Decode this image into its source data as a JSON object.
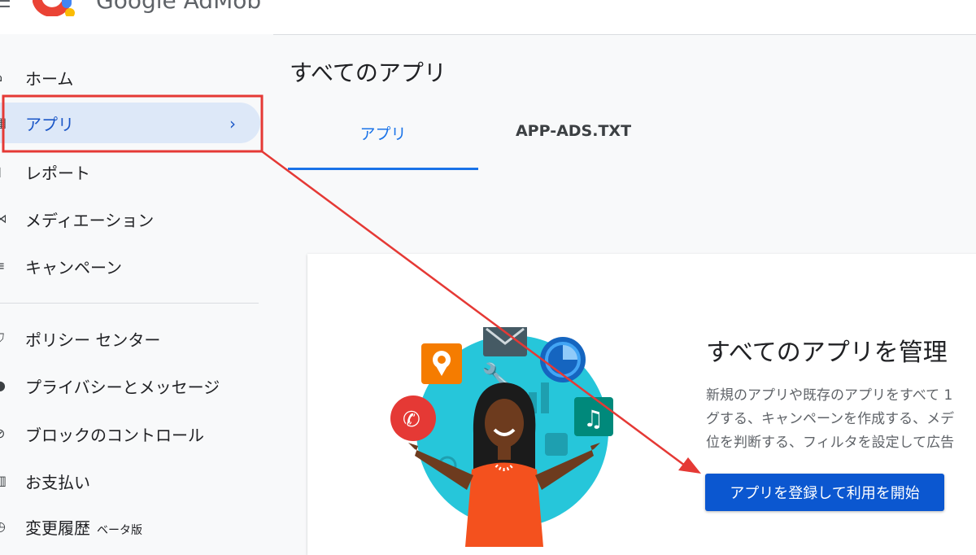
{
  "app": {
    "brand": "Google AdMob"
  },
  "sidebar": {
    "items": [
      {
        "label": "ホーム",
        "icon": "home-icon"
      },
      {
        "label": "アプリ",
        "icon": "apps-icon",
        "active": true
      },
      {
        "label": "レポート",
        "icon": "reports-icon"
      },
      {
        "label": "メディエーション",
        "icon": "mediation-icon"
      },
      {
        "label": "キャンペーン",
        "icon": "campaigns-icon"
      },
      {
        "label": "ポリシー センター",
        "icon": "policy-shield-icon"
      },
      {
        "label": "プライバシーとメッセージ",
        "icon": "privacy-person-icon"
      },
      {
        "label": "ブロックのコントロール",
        "icon": "block-icon"
      },
      {
        "label": "お支払い",
        "icon": "payments-icon"
      },
      {
        "label": "変更履歴",
        "icon": "history-icon",
        "badge": "ベータ版"
      }
    ]
  },
  "main": {
    "title": "すべてのアプリ",
    "tabs": [
      {
        "label": "アプリ",
        "active": true
      },
      {
        "label": "APP-ADS.TXT"
      }
    ]
  },
  "card": {
    "title": "すべてのアプリを管理",
    "description_lines": [
      "新規のアプリや既存のアプリをすべて 1",
      "グする、キャンペーンを作成する、メデ",
      "位を判断する、フィルタを設定して広告"
    ],
    "cta_label": "アプリを登録して利用を開始"
  },
  "colors": {
    "accent": "#1a73e8",
    "cta": "#0b57d0",
    "active_nav_bg": "#dde8f8",
    "annotation": "#e53935"
  }
}
